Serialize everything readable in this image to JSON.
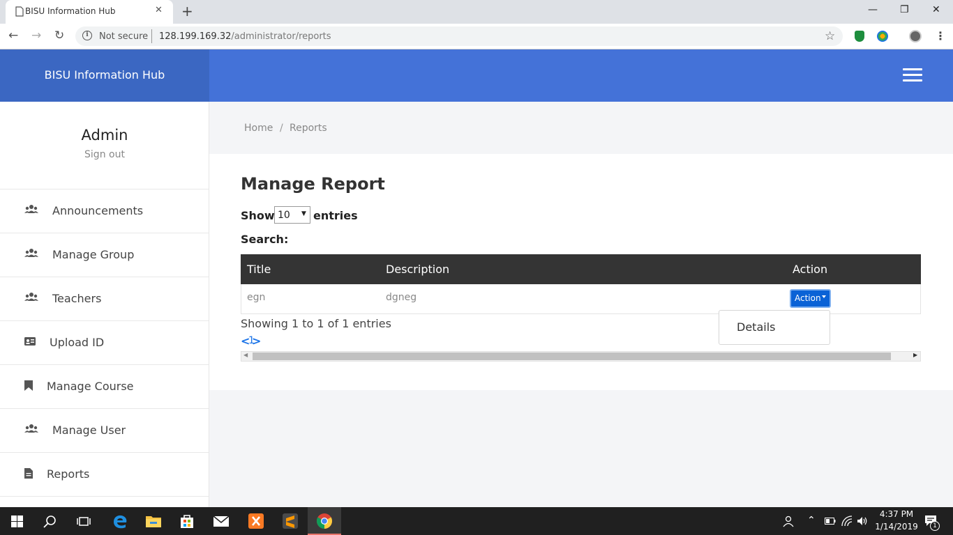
{
  "browser": {
    "tab_title": "BISU Information Hub",
    "tab_close": "✕",
    "new_tab": "+",
    "security_label": "Not secure",
    "url_host": "128.199.169.32",
    "url_path": "/administrator/reports",
    "window_controls": {
      "minimize": "—",
      "restore": "❐",
      "close": "✕"
    }
  },
  "app": {
    "brand": "BISU Information Hub",
    "accent_color": "#4472d8",
    "brand_bg_color": "#3b67c2"
  },
  "sidebar": {
    "user_name": "Admin",
    "sign_out": "Sign out",
    "items": [
      {
        "label": "Announcements",
        "icon": "users-icon"
      },
      {
        "label": "Manage Group",
        "icon": "users-icon"
      },
      {
        "label": "Teachers",
        "icon": "users-icon"
      },
      {
        "label": "Upload ID",
        "icon": "id-card-icon"
      },
      {
        "label": "Manage Course",
        "icon": "bookmark-icon"
      },
      {
        "label": "Manage User",
        "icon": "users-icon"
      },
      {
        "label": "Reports",
        "icon": "file-icon"
      }
    ]
  },
  "breadcrumb": {
    "home": "Home",
    "separator": "/",
    "current": "Reports"
  },
  "main": {
    "title": "Manage Report",
    "show_label": "Show",
    "entries_value": "10",
    "entries_label": "entries",
    "search_label": "Search:",
    "table": {
      "headers": [
        "Title",
        "Description",
        "Action"
      ],
      "rows": [
        {
          "title": "egn",
          "description": "dgneg",
          "action": "Action"
        }
      ]
    },
    "dropdown_items": [
      "Details"
    ],
    "showing_text": "Showing 1 to 1 of 1 entries",
    "pagination": {
      "prev": "<",
      "page": "1",
      "next": ">"
    }
  },
  "taskbar": {
    "time": "4:37 PM",
    "date": "1/14/2019",
    "notification_count": "1"
  }
}
